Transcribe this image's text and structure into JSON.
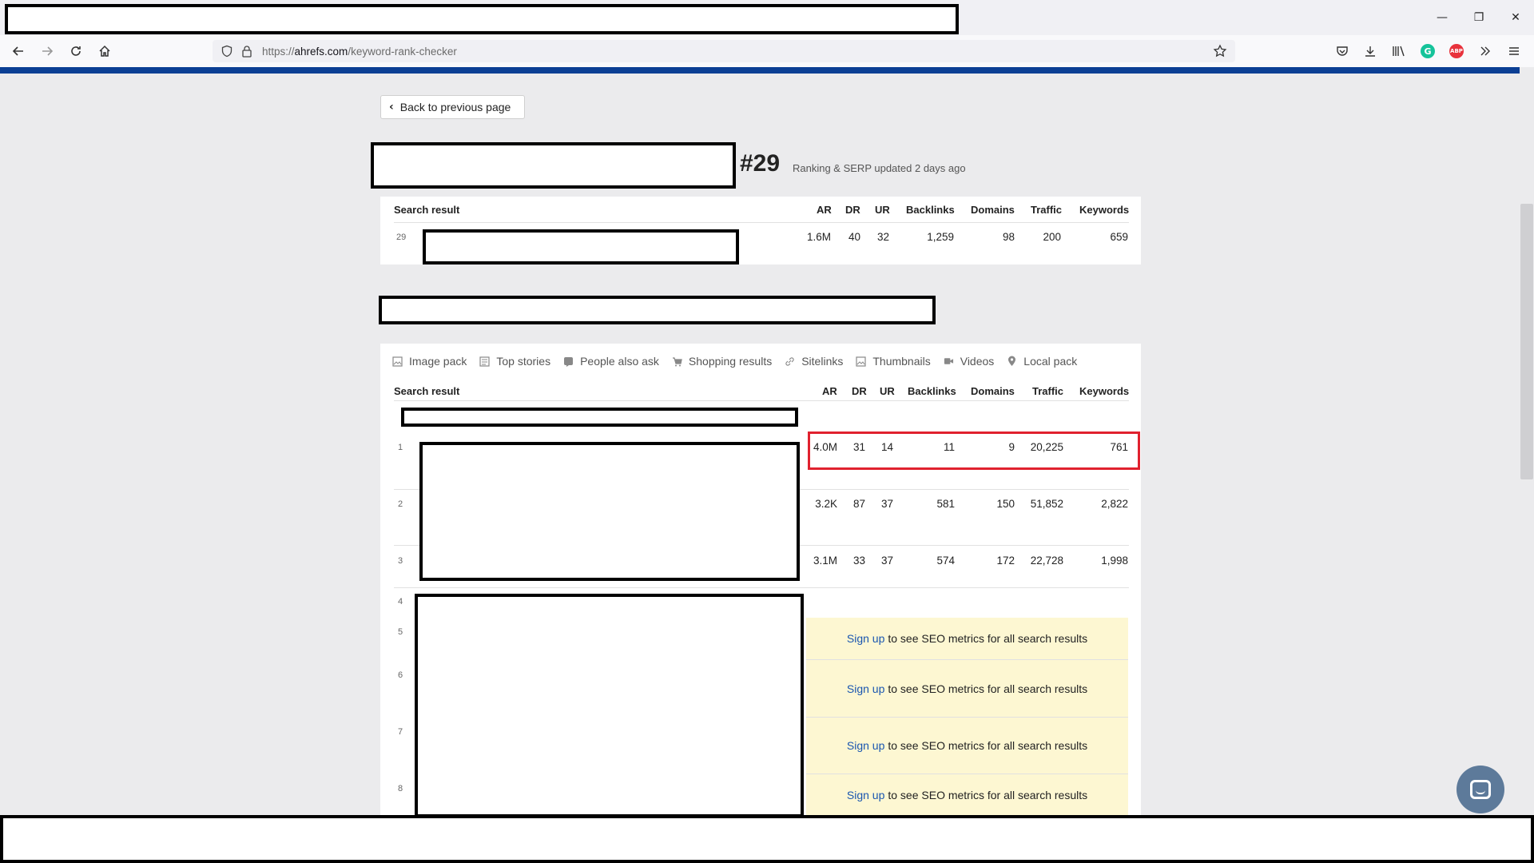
{
  "browser": {
    "url_prefix": "https://",
    "url_host": "ahrefs.com",
    "url_path": "/keyword-rank-checker",
    "window_controls": {
      "minimize": "—",
      "restore": "❐",
      "close": "✕"
    }
  },
  "page": {
    "back_label": "Back to previous page",
    "rank_heading": "#29",
    "updated_text": "Ranking & SERP updated 2 days ago"
  },
  "columns": [
    "AR",
    "DR",
    "UR",
    "Backlinks",
    "Domains",
    "Traffic",
    "Keywords"
  ],
  "search_result_label": "Search result",
  "own_result": {
    "position": "29",
    "ar": "1.6M",
    "dr": "40",
    "ur": "32",
    "backlinks": "1,259",
    "domains": "98",
    "traffic": "200",
    "keywords": "659"
  },
  "serp_features": [
    {
      "label": "Image pack",
      "icon": "image-icon"
    },
    {
      "label": "Top stories",
      "icon": "news-icon"
    },
    {
      "label": "People also ask",
      "icon": "question-icon"
    },
    {
      "label": "Shopping results",
      "icon": "cart-icon"
    },
    {
      "label": "Sitelinks",
      "icon": "link-icon"
    },
    {
      "label": "Thumbnails",
      "icon": "thumbnail-icon"
    },
    {
      "label": "Videos",
      "icon": "video-icon"
    },
    {
      "label": "Local pack",
      "icon": "pin-icon"
    }
  ],
  "serp_rows": [
    {
      "position": "1",
      "ar": "4.0M",
      "dr": "31",
      "ur": "14",
      "backlinks": "11",
      "domains": "9",
      "traffic": "20,225",
      "keywords": "761"
    },
    {
      "position": "2",
      "ar": "3.2K",
      "dr": "87",
      "ur": "37",
      "backlinks": "581",
      "domains": "150",
      "traffic": "51,852",
      "keywords": "2,822"
    },
    {
      "position": "3",
      "ar": "3.1M",
      "dr": "33",
      "ur": "37",
      "backlinks": "574",
      "domains": "172",
      "traffic": "22,728",
      "keywords": "1,998"
    }
  ],
  "locked_positions": [
    "4",
    "5",
    "6",
    "7",
    "8"
  ],
  "signup": {
    "link": "Sign up",
    "text": "to see SEO metrics for all search results"
  },
  "colors": {
    "accent_bar": "#0b3f94",
    "highlight": "#e0212e",
    "signup_bg": "#fdf7d2",
    "link": "#1a56b0"
  }
}
